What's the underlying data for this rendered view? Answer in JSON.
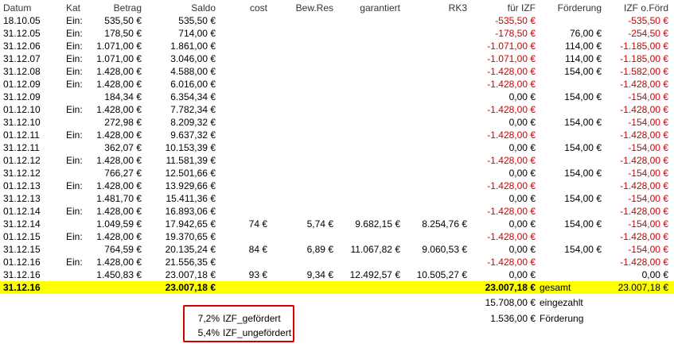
{
  "header": [
    "Datum",
    "Kat",
    "Betrag",
    "Saldo",
    "cost",
    "Bew.Res",
    "garantiert",
    "RK3",
    "für IZF",
    "Förderung",
    "IZF o.Förd"
  ],
  "rows": [
    [
      "18.10.05",
      "Ein:",
      "535,50 €",
      "535,50 €",
      "",
      "",
      "",
      "",
      "-535,50 €",
      "",
      "-535,50 €"
    ],
    [
      "31.12.05",
      "Ein:",
      "178,50 €",
      "714,00 €",
      "",
      "",
      "",
      "",
      "-178,50 €",
      "76,00 €",
      "-254,50 €"
    ],
    [
      "31.12.06",
      "Ein:",
      "1.071,00 €",
      "1.861,00 €",
      "",
      "",
      "",
      "",
      "-1.071,00 €",
      "114,00 €",
      "-1.185,00 €"
    ],
    [
      "31.12.07",
      "Ein:",
      "1.071,00 €",
      "3.046,00 €",
      "",
      "",
      "",
      "",
      "-1.071,00 €",
      "114,00 €",
      "-1.185,00 €"
    ],
    [
      "31.12.08",
      "Ein:",
      "1.428,00 €",
      "4.588,00 €",
      "",
      "",
      "",
      "",
      "-1.428,00 €",
      "154,00 €",
      "-1.582,00 €"
    ],
    [
      "01.12.09",
      "Ein:",
      "1.428,00 €",
      "6.016,00 €",
      "",
      "",
      "",
      "",
      "-1.428,00 €",
      "",
      "-1.428,00 €"
    ],
    [
      "31.12.09",
      "",
      "184,34 €",
      "6.354,34 €",
      "",
      "",
      "",
      "",
      "0,00 €",
      "154,00 €",
      "-154,00 €"
    ],
    [
      "01.12.10",
      "Ein:",
      "1.428,00 €",
      "7.782,34 €",
      "",
      "",
      "",
      "",
      "-1.428,00 €",
      "",
      "-1.428,00 €"
    ],
    [
      "31.12.10",
      "",
      "272,98 €",
      "8.209,32 €",
      "",
      "",
      "",
      "",
      "0,00 €",
      "154,00 €",
      "-154,00 €"
    ],
    [
      "01.12.11",
      "Ein:",
      "1.428,00 €",
      "9.637,32 €",
      "",
      "",
      "",
      "",
      "-1.428,00 €",
      "",
      "-1.428,00 €"
    ],
    [
      "31.12.11",
      "",
      "362,07 €",
      "10.153,39 €",
      "",
      "",
      "",
      "",
      "0,00 €",
      "154,00 €",
      "-154,00 €"
    ],
    [
      "01.12.12",
      "Ein:",
      "1.428,00 €",
      "11.581,39 €",
      "",
      "",
      "",
      "",
      "-1.428,00 €",
      "",
      "-1.428,00 €"
    ],
    [
      "31.12.12",
      "",
      "766,27 €",
      "12.501,66 €",
      "",
      "",
      "",
      "",
      "0,00 €",
      "154,00 €",
      "-154,00 €"
    ],
    [
      "01.12.13",
      "Ein:",
      "1.428,00 €",
      "13.929,66 €",
      "",
      "",
      "",
      "",
      "-1.428,00 €",
      "",
      "-1.428,00 €"
    ],
    [
      "31.12.13",
      "",
      "1.481,70 €",
      "15.411,36 €",
      "",
      "",
      "",
      "",
      "0,00 €",
      "154,00 €",
      "-154,00 €"
    ],
    [
      "01.12.14",
      "Ein:",
      "1.428,00 €",
      "16.893,06 €",
      "",
      "",
      "",
      "",
      "-1.428,00 €",
      "",
      "-1.428,00 €"
    ],
    [
      "31.12.14",
      "",
      "1.049,59 €",
      "17.942,65 €",
      "74 €",
      "5,74 €",
      "9.682,15 €",
      "8.254,76 €",
      "0,00 €",
      "154,00 €",
      "-154,00 €"
    ],
    [
      "01.12.15",
      "Ein:",
      "1.428,00 €",
      "19.370,65 €",
      "",
      "",
      "",
      "",
      "-1.428,00 €",
      "",
      "-1.428,00 €"
    ],
    [
      "31.12.15",
      "",
      "764,59 €",
      "20.135,24 €",
      "84 €",
      "6,89 €",
      "11.067,82 €",
      "9.060,53 €",
      "0,00 €",
      "154,00 €",
      "-154,00 €"
    ],
    [
      "01.12.16",
      "Ein:",
      "1.428,00 €",
      "21.556,35 €",
      "",
      "",
      "",
      "",
      "-1.428,00 €",
      "",
      "-1.428,00 €"
    ],
    [
      "31.12.16",
      "",
      "1.450,83 €",
      "23.007,18 €",
      "93 €",
      "9,34 €",
      "12.492,57 €",
      "10.505,27 €",
      "0,00 €",
      "",
      "0,00 €"
    ]
  ],
  "total_row": {
    "date": "31.12.16",
    "saldo": "23.007,18 €",
    "fuer_izf": "23.007,18 €",
    "label": "gesamt",
    "izf_o_foerd": "23.007,18 €"
  },
  "summary": [
    {
      "value": "15.708,00 €",
      "label": "eingezahlt"
    },
    {
      "value": "1.536,00 €",
      "label": "Förderung"
    }
  ],
  "legend": [
    {
      "value": "7,2%",
      "label": "IZF_gefördert"
    },
    {
      "value": "5,4%",
      "label": "IZF_ungefördert"
    }
  ],
  "colors": {
    "highlight": "#ffff00",
    "negative": "#cc0000",
    "box_border": "#d40000"
  }
}
